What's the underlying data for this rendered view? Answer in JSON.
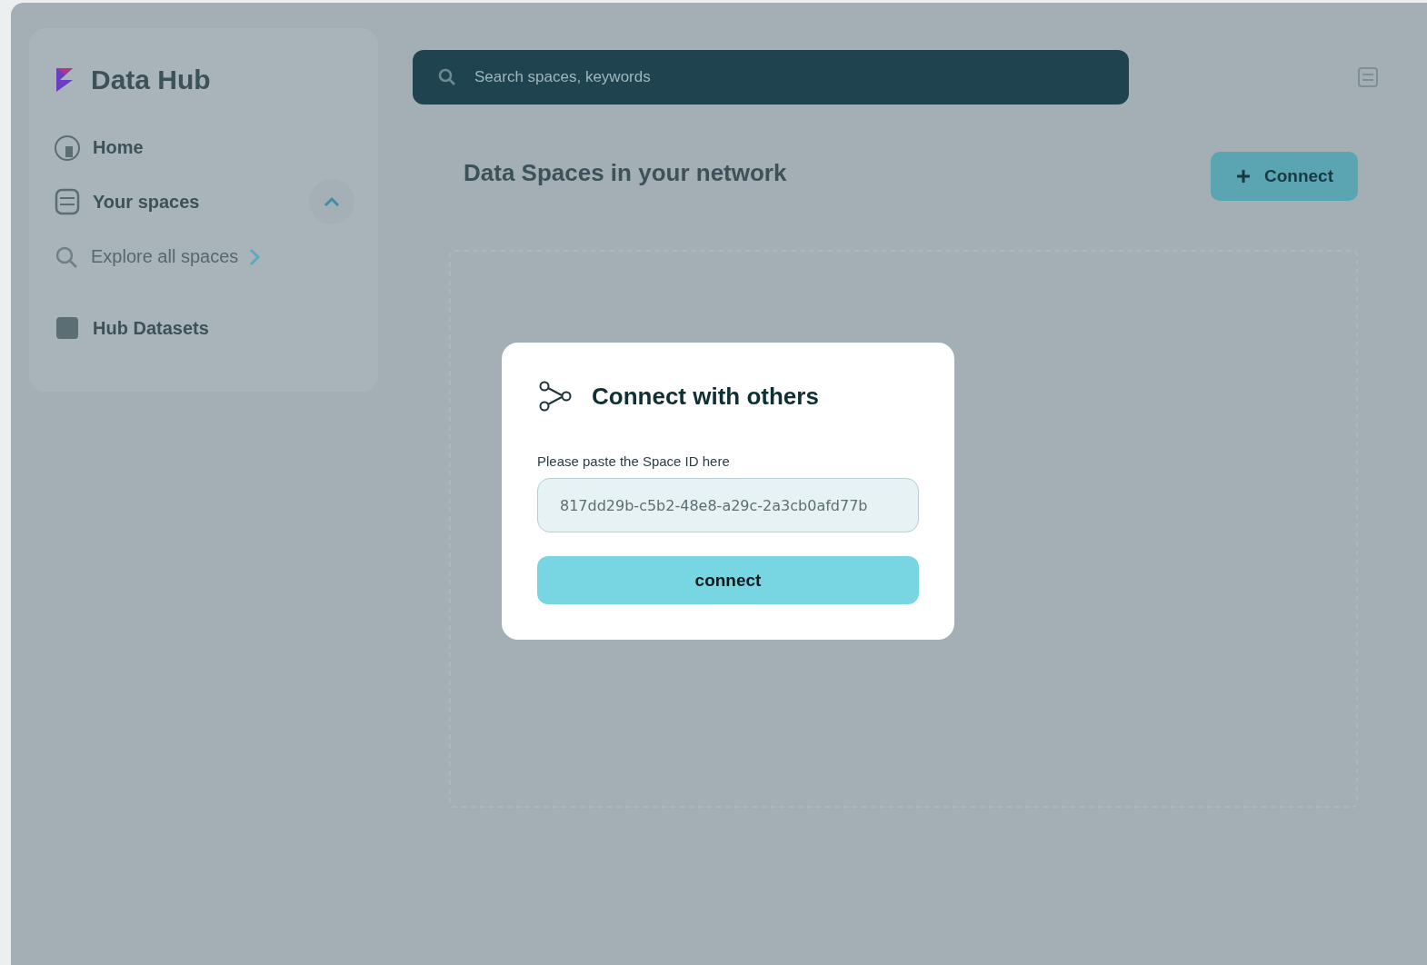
{
  "sidebar": {
    "app_name": "Data Hub",
    "items": [
      {
        "kind": "item",
        "label": "Home"
      },
      {
        "kind": "group",
        "label": "Your spaces",
        "expanded": true
      },
      {
        "kind": "subitem",
        "label": "Explore all spaces"
      },
      {
        "kind": "item",
        "label": "Hub Datasets"
      }
    ]
  },
  "search": {
    "placeholder": "Search spaces, keywords"
  },
  "content": {
    "heading": "Data Spaces in your network",
    "button": "Connect"
  },
  "dialog": {
    "title": "Connect with others",
    "field_label": "Please paste the Space ID here",
    "field_value": "817dd29b-c5b2-48e8-a29c-2a3cb0afd77b",
    "button": "connect"
  }
}
